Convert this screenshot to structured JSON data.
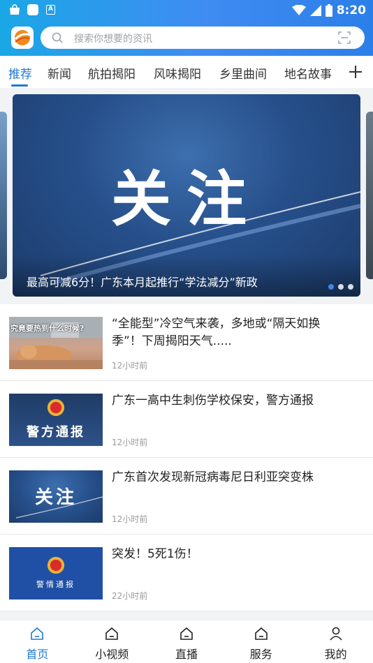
{
  "status_bar": {
    "time": "8:20"
  },
  "search": {
    "placeholder": "搜索你想要的资讯"
  },
  "tabs": [
    {
      "label": "推荐",
      "active": true
    },
    {
      "label": "新闻",
      "active": false
    },
    {
      "label": "航拍揭阳",
      "active": false
    },
    {
      "label": "风味揭阳",
      "active": false
    },
    {
      "label": "乡里曲间",
      "active": false
    },
    {
      "label": "地名故事",
      "active": false
    }
  ],
  "banner": {
    "image_text": "关注",
    "caption": "最高可减6分！广东本月起推行“学法减分”新政",
    "dots_total": 3,
    "dots_active": 1
  },
  "feed": [
    {
      "title": "“全能型”冷空气来袭，多地或“隔天如换季”！下周揭阳天气.....",
      "time": "12小时前",
      "thumb_text": "究竟要热到什么时候?"
    },
    {
      "title": "广东一高中生刺伤学校保安，警方通报",
      "time": "12小时前",
      "thumb_text": "警方通报"
    },
    {
      "title": "广东首次发现新冠病毒尼日利亚突变株",
      "time": "12小时前",
      "thumb_text": "关注"
    },
    {
      "title": "突发！5死1伤！",
      "time": "22小时前",
      "thumb_text": "警情通报"
    }
  ],
  "bottom_nav": [
    {
      "label": "首页",
      "icon": "home-icon",
      "active": true
    },
    {
      "label": "小视频",
      "icon": "home-icon",
      "active": false
    },
    {
      "label": "直播",
      "icon": "home-icon",
      "active": false
    },
    {
      "label": "服务",
      "icon": "home-icon",
      "active": false
    },
    {
      "label": "我的",
      "icon": "person-icon",
      "active": false
    }
  ],
  "colors": {
    "accent": "#1e78d8",
    "header_start": "#1aa7e6",
    "header_end": "#2b7fe8"
  }
}
